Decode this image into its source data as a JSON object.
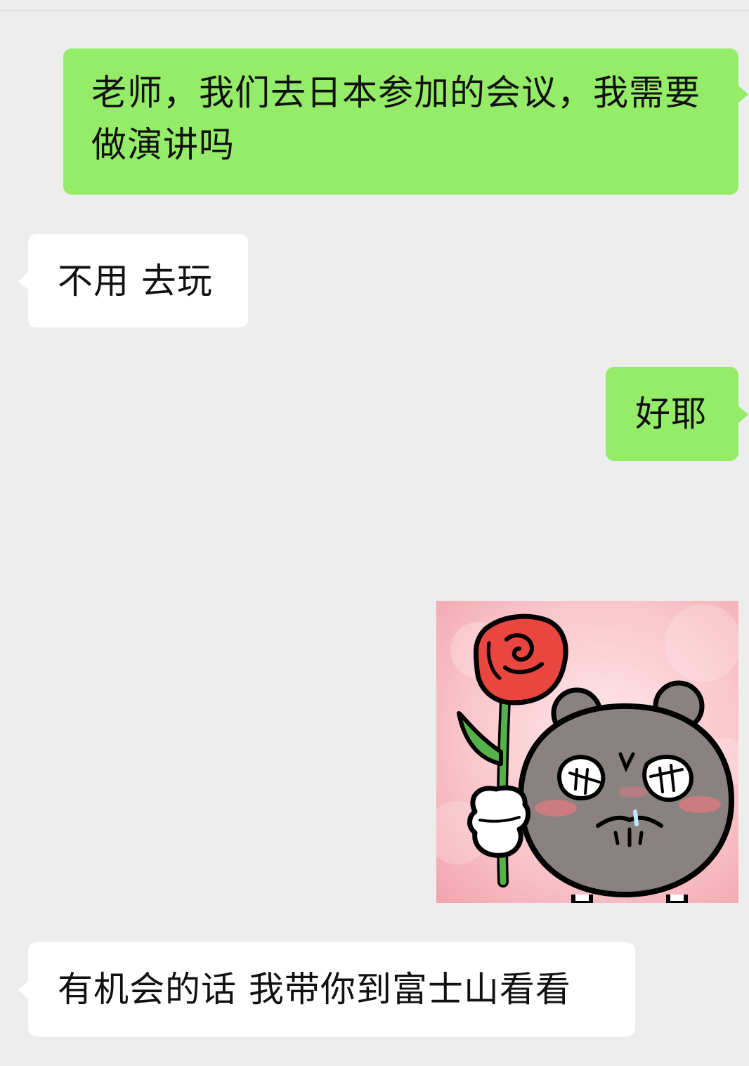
{
  "messages": [
    {
      "direction": "outgoing",
      "type": "text",
      "text": "老师，我们去日本参加的会议，我需要做演讲吗"
    },
    {
      "direction": "incoming",
      "type": "text",
      "text": "不用 去玩"
    },
    {
      "direction": "outgoing",
      "type": "text",
      "text": "好耶"
    },
    {
      "direction": "outgoing",
      "type": "sticker",
      "sticker": "bear-holding-rose-sticker"
    },
    {
      "direction": "incoming",
      "type": "text",
      "text": "有机会的话 我带你到富士山看看"
    }
  ],
  "colors": {
    "background": "#ededed",
    "outgoing_bubble": "#95ec69",
    "incoming_bubble": "#ffffff",
    "text": "#111111"
  }
}
